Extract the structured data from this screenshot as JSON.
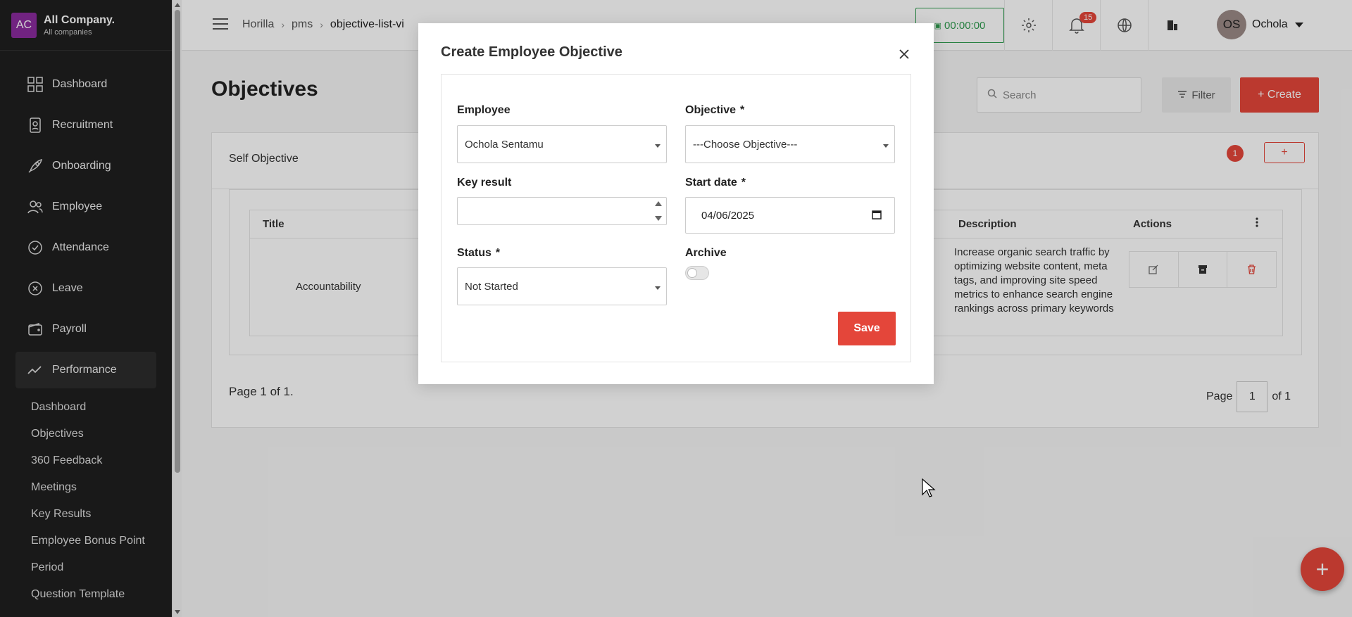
{
  "company": {
    "logo": "AC",
    "name": "All Company.",
    "subtitle": "All companies"
  },
  "sidebar": {
    "items": [
      {
        "label": "Dashboard",
        "icon": "dashboard-icon"
      },
      {
        "label": "Recruitment",
        "icon": "recruitment-icon"
      },
      {
        "label": "Onboarding",
        "icon": "rocket-icon"
      },
      {
        "label": "Employee",
        "icon": "people-icon"
      },
      {
        "label": "Attendance",
        "icon": "check-circle-icon"
      },
      {
        "label": "Leave",
        "icon": "x-circle-icon"
      },
      {
        "label": "Payroll",
        "icon": "wallet-icon"
      },
      {
        "label": "Performance",
        "icon": "trend-icon"
      }
    ],
    "subitems": [
      "Dashboard",
      "Objectives",
      "360 Feedback",
      "Meetings",
      "Key Results",
      "Employee Bonus Point",
      "Period",
      "Question Template"
    ]
  },
  "header": {
    "breadcrumb": [
      "Horilla",
      "pms",
      "objective-list-vi"
    ],
    "timer": "00:00:00",
    "notifications": "15",
    "user_initials": "OS",
    "user_name": "Ochola"
  },
  "main": {
    "title": "Objectives",
    "search_placeholder": "Search",
    "filter_label": "Filter",
    "create_label": "+ Create",
    "section_label": "Self Objective",
    "section_count": "1",
    "section_plus": "+",
    "columns": {
      "title": "Title",
      "description": "Description",
      "actions": "Actions"
    },
    "row": {
      "title": "Accountability",
      "description": "Increase organic search traffic by optimizing website content, meta tags, and improving site speed metrics to enhance search engine rankings across primary keywords"
    },
    "pagination_left": "Page 1 of 1.",
    "pagination_page_label": "Page",
    "pagination_page": "1",
    "pagination_of": "of 1"
  },
  "modal": {
    "title": "Create Employee Objective",
    "employee_label": "Employee",
    "employee_value": "Ochola Sentamu",
    "objective_label": "Objective",
    "objective_value": "---Choose Objective---",
    "key_result_label": "Key result",
    "start_date_label": "Start date",
    "start_date_value": "04/06/2025",
    "status_label": "Status",
    "status_value": "Not Started",
    "archive_label": "Archive",
    "archive_checked": false,
    "save_label": "Save",
    "required_mark": "*"
  },
  "colors": {
    "accent": "#e4463a",
    "sidebar_bg": "#1f1f1f",
    "timer_green": "#2e9b4e"
  }
}
